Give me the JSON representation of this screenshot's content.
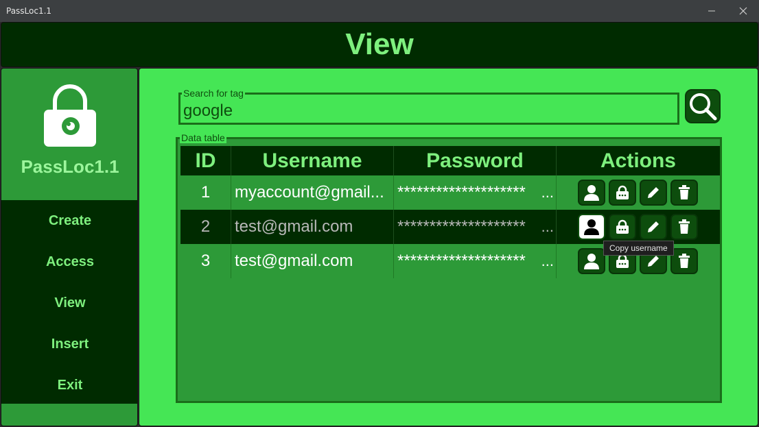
{
  "window": {
    "title": "PassLoc1.1"
  },
  "header": {
    "title": "View"
  },
  "sidebar": {
    "brand": "PassLoc1.1",
    "items": [
      {
        "label": "Create"
      },
      {
        "label": "Access"
      },
      {
        "label": "View"
      },
      {
        "label": "Insert"
      },
      {
        "label": "Exit"
      }
    ]
  },
  "search": {
    "legend": "Search for tag",
    "value": "google"
  },
  "table": {
    "legend": "Data table",
    "columns": [
      "ID",
      "Username",
      "Password",
      "Actions"
    ],
    "rows": [
      {
        "id": "1",
        "username": "myaccount@gmail...",
        "password": "********************",
        "ellipsis": "..."
      },
      {
        "id": "2",
        "username": "test@gmail.com",
        "password": "********************",
        "ellipsis": "..."
      },
      {
        "id": "3",
        "username": "test@gmail.com",
        "password": "********************",
        "ellipsis": "..."
      }
    ],
    "selected_row": 2
  },
  "tooltip": {
    "text": "Copy username"
  },
  "colors": {
    "dark_green": "#002b00",
    "mid_green": "#2d9a38",
    "bright_green": "#45e655",
    "accent_text": "#7ef07e"
  },
  "icons": [
    "user-icon",
    "lock-icon",
    "pencil-icon",
    "trash-icon",
    "search-icon",
    "minimize-icon",
    "close-icon",
    "padlock-eye-icon"
  ]
}
